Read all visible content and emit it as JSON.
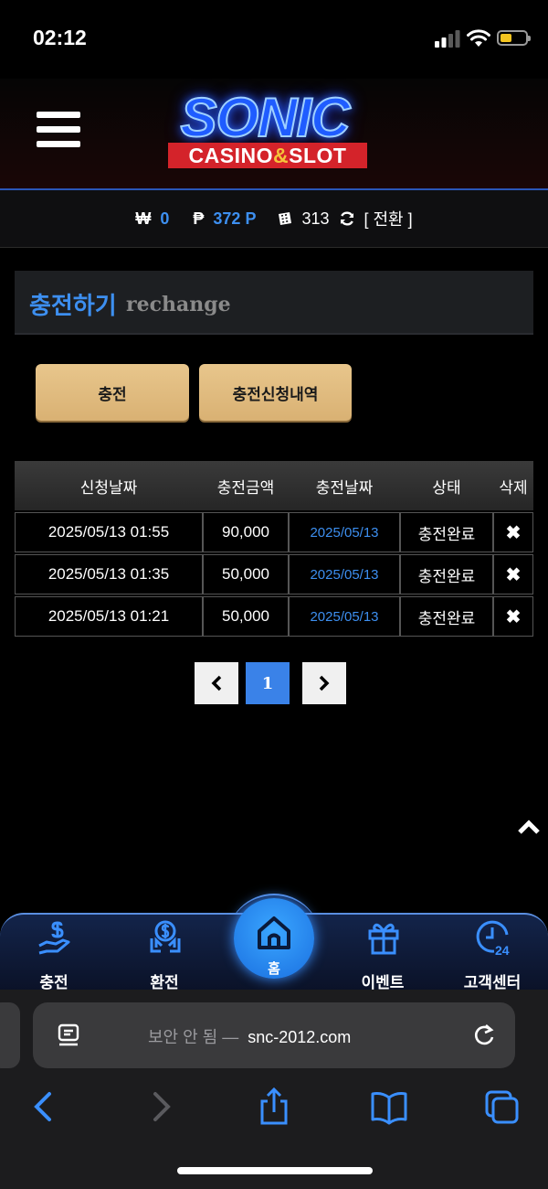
{
  "status_bar": {
    "time": "02:12",
    "battery_color": "#f5c520"
  },
  "header": {
    "menu_icon": "hamburger-icon",
    "logo_main": "SONIC",
    "logo_sub_a": "CASINO",
    "logo_sub_amp": "&",
    "logo_sub_b": "SLOT"
  },
  "balance": {
    "won_symbol": "₩",
    "won_value": "0",
    "point_symbol": "₱",
    "point_value": "372 P",
    "chip_count": "313",
    "convert_label": "[ 전환 ]"
  },
  "section": {
    "title_ko": "충전하기",
    "title_en": "rechange"
  },
  "actions": {
    "charge_label": "충전",
    "history_label": "충전신청내역"
  },
  "table": {
    "headers": [
      "신청날짜",
      "충전금액",
      "충전날짜",
      "상태",
      "삭제"
    ],
    "rows": [
      {
        "request_date": "2025/05/13 01:55",
        "amount": "90,000",
        "charge_date": "2025/05/13",
        "status": "충전완료",
        "delete": "✖"
      },
      {
        "request_date": "2025/05/13 01:35",
        "amount": "50,000",
        "charge_date": "2025/05/13",
        "status": "충전완료",
        "delete": "✖"
      },
      {
        "request_date": "2025/05/13 01:21",
        "amount": "50,000",
        "charge_date": "2025/05/13",
        "status": "충전완료",
        "delete": "✖"
      }
    ]
  },
  "pagination": {
    "current": "1"
  },
  "bottom_nav": {
    "items": [
      {
        "label": "충전",
        "icon": "hand-money-icon"
      },
      {
        "label": "환전",
        "icon": "exchange-icon"
      },
      {
        "label": "홈",
        "icon": "home-icon"
      },
      {
        "label": "이벤트",
        "icon": "gift-icon"
      },
      {
        "label": "고객센터",
        "icon": "support-24-icon"
      }
    ],
    "accent": "#3a8fff"
  },
  "browser": {
    "insecure_label": "보안 안 됨 —",
    "domain": "snc-2012.com"
  }
}
